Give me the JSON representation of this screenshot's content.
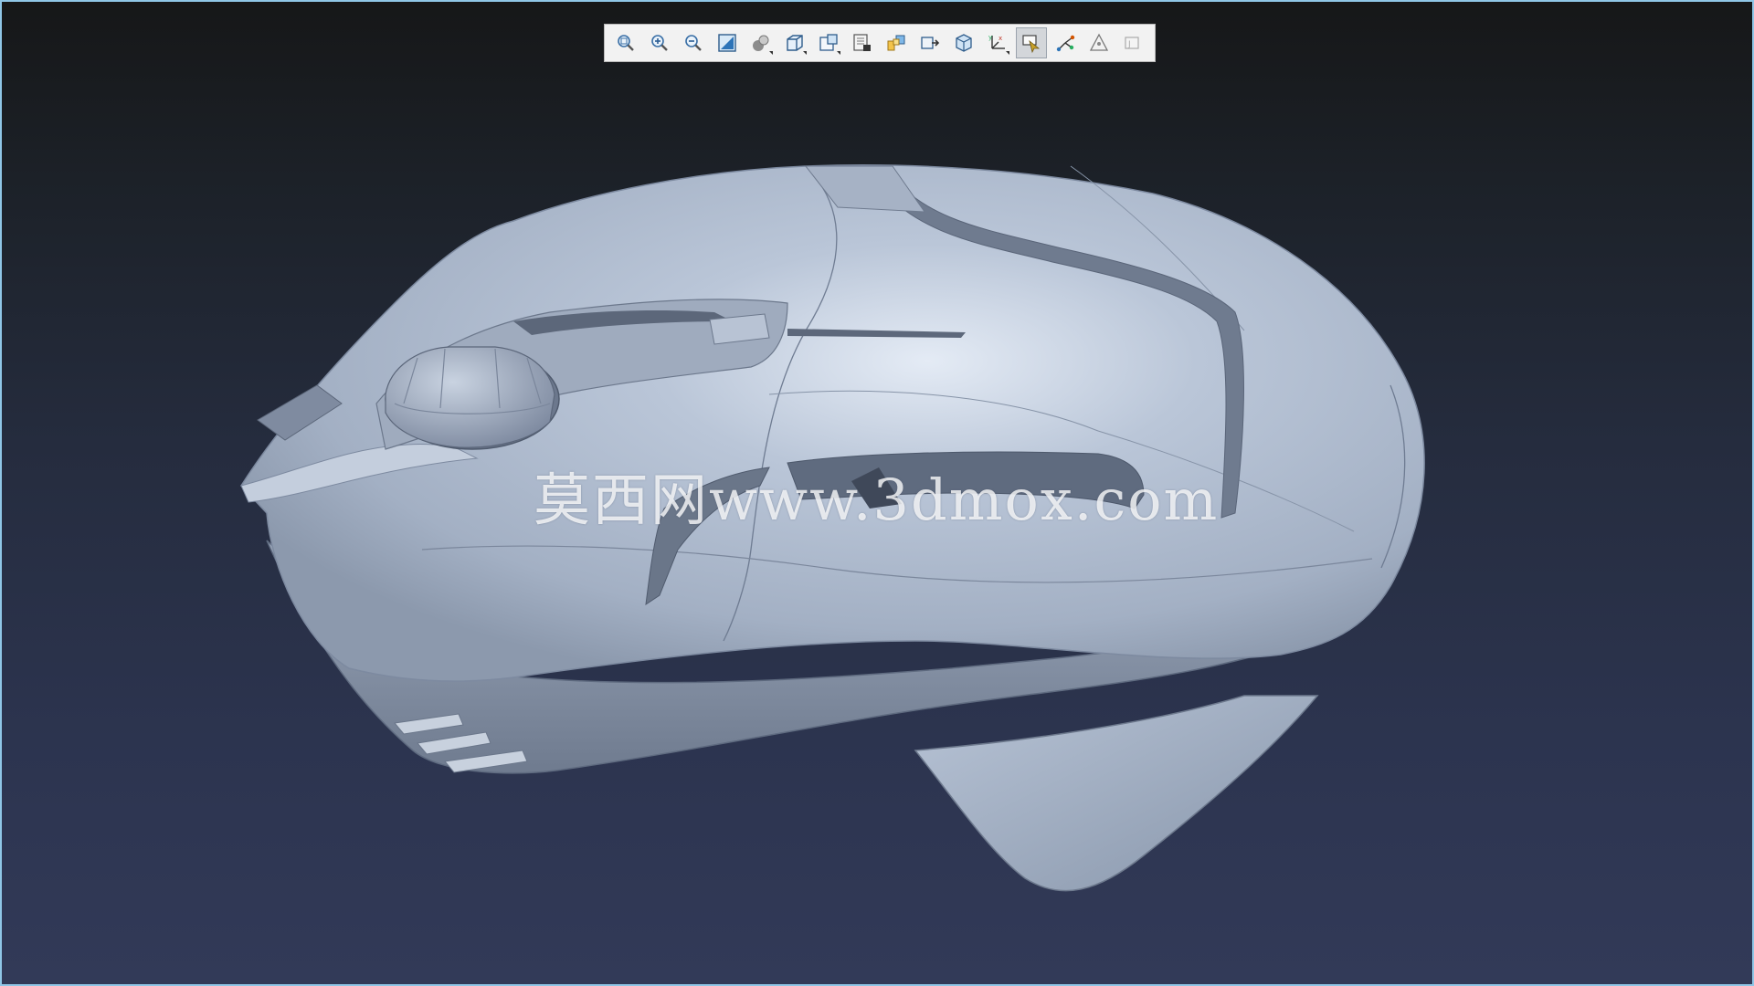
{
  "viewer": {
    "background_top": "#161718",
    "background_bottom": "#323a58",
    "border_color": "#8fc6e6",
    "model_color": "#aab6c8"
  },
  "toolbar": {
    "tools": [
      {
        "name": "zoom-fit-icon",
        "active": false
      },
      {
        "name": "zoom-in-icon",
        "active": false
      },
      {
        "name": "zoom-out-icon",
        "active": false
      },
      {
        "name": "zoom-window-icon",
        "active": false
      },
      {
        "name": "shading-style-icon",
        "active": false
      },
      {
        "name": "view-cube-icon",
        "active": false
      },
      {
        "name": "view-orientation-icon",
        "active": false
      },
      {
        "name": "display-settings-icon",
        "active": false
      },
      {
        "name": "layers-icon",
        "active": false
      },
      {
        "name": "view-manager-icon",
        "active": false
      },
      {
        "name": "saved-views-icon",
        "active": false
      },
      {
        "name": "coordinate-systems-icon",
        "active": false
      },
      {
        "name": "selection-filter-icon",
        "active": true
      },
      {
        "name": "datum-axis-icon",
        "active": false
      },
      {
        "name": "datum-points-icon",
        "active": false
      },
      {
        "name": "annotations-icon",
        "active": false
      }
    ]
  },
  "watermark": {
    "text": "莫西网www.3dmox.com"
  }
}
